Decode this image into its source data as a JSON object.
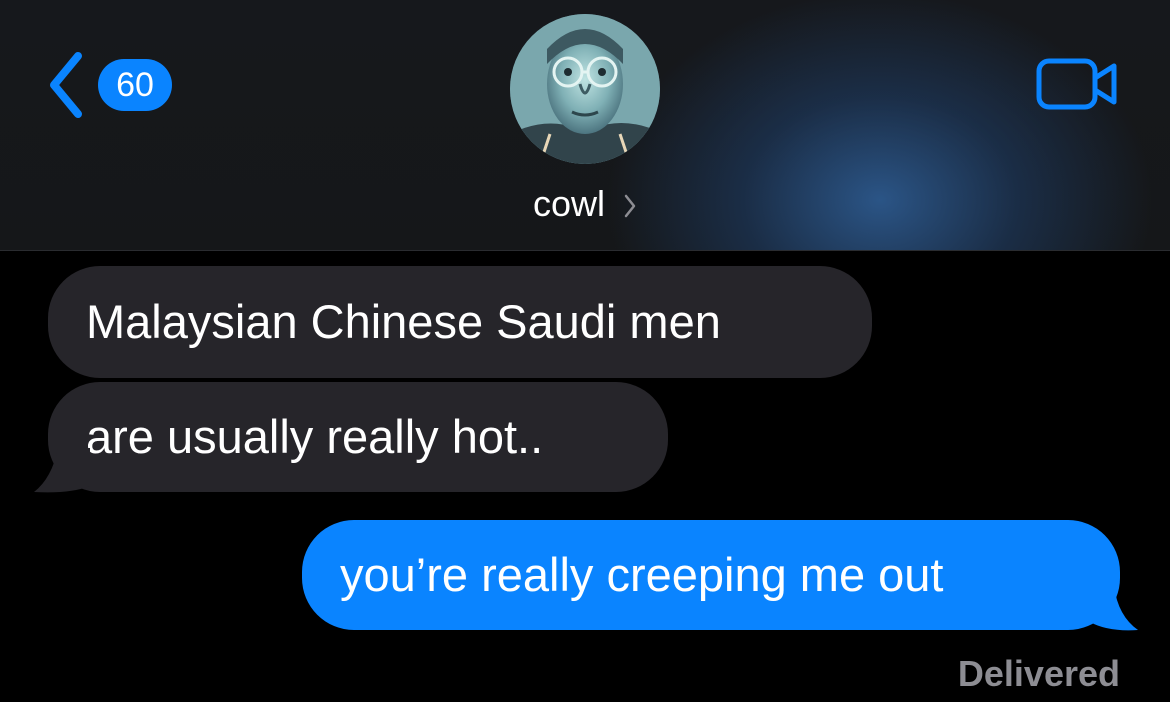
{
  "header": {
    "back_badge_count": "60",
    "contact_name": "cowl"
  },
  "messages": [
    {
      "direction": "incoming",
      "text": "Malaysian Chinese Saudi men"
    },
    {
      "direction": "incoming",
      "text": "are usually really hot.."
    },
    {
      "direction": "outgoing",
      "text": "you’re really creeping me out"
    }
  ],
  "status": {
    "delivery_label": "Delivered"
  },
  "icons": {
    "back": "chevron-left-icon",
    "video": "video-camera-icon",
    "contact_disclosure": "chevron-right-icon"
  },
  "colors": {
    "accent": "#0a84ff",
    "incoming_bubble": "#26252a",
    "background": "#000000",
    "status_text": "#8d8d93"
  }
}
